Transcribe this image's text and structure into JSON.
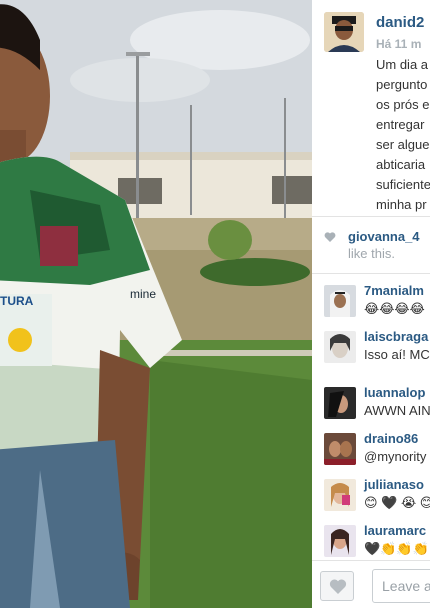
{
  "post": {
    "username": "danid2",
    "time_ago": "Há 11 m",
    "caption_lines": [
      "Um dia a",
      "pergunto",
      "os prós e",
      "entregar",
      "ser algue",
      "abticaria",
      "suficiente",
      "minha pr"
    ]
  },
  "likes": {
    "first_user": "giovanna_4",
    "tail": "like this."
  },
  "comments": [
    {
      "user": "7manialm",
      "text": "😂😂😂😂"
    },
    {
      "user": "laiscbraga",
      "text": "Isso aí! MC"
    },
    {
      "user": "luannalop",
      "text": "AWWN AIN"
    },
    {
      "user": "draino86",
      "text": "@mynority"
    },
    {
      "user": "juliianaso",
      "text": "😊 🖤 😭 😊"
    },
    {
      "user": "lauramarc",
      "text": "🖤👏👏👏"
    }
  ],
  "footer": {
    "comment_placeholder": "Leave a"
  },
  "colors": {
    "username": "#2b5a83",
    "muted": "#a9b1b7",
    "border": "#e3e3e3"
  }
}
